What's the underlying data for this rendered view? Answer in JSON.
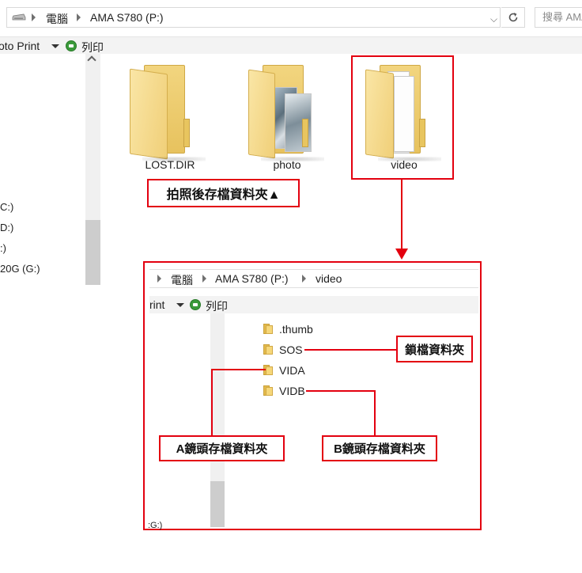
{
  "address_bar": {
    "crumbs": [
      "電腦",
      "AMA S780 (P:)"
    ],
    "search_placeholder": "搜尋 AMA"
  },
  "toolbar": {
    "slideshow_label": "oto Print",
    "print_label": "列印"
  },
  "nav_pane": {
    "items": [
      "C:)",
      "D:)",
      ":)",
      "20G (G:)"
    ]
  },
  "folders": [
    {
      "name": "LOST.DIR"
    },
    {
      "name": "photo"
    },
    {
      "name": "video"
    }
  ],
  "annotations": {
    "photo_note": "拍照後存檔資料夾▲",
    "sos_note": "鎖檔資料夾",
    "vida_note": "A鏡頭存檔資料夾",
    "vidb_note": "B鏡頭存檔資料夾"
  },
  "inset": {
    "crumbs": [
      "電腦",
      "AMA S780 (P:)",
      "video"
    ],
    "toolbar_text": "rint",
    "print_label": "列印",
    "items": [
      ".thumb",
      "SOS",
      "VIDA",
      "VIDB"
    ],
    "nav_bottom": ":G:)"
  },
  "colors": {
    "annotation_red": "#e3000f",
    "folder_yellow": "#f0cf78",
    "print_green": "#3a9a3a"
  }
}
